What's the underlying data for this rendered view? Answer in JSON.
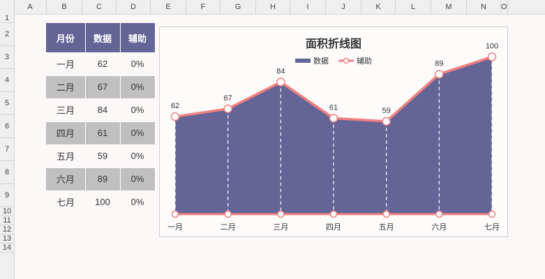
{
  "sheet": {
    "columns": [
      "A",
      "B",
      "C",
      "D",
      "E",
      "F",
      "G",
      "H",
      "I",
      "J",
      "K",
      "L",
      "M",
      "N",
      "O"
    ],
    "rows": [
      "1",
      "2",
      "3",
      "4",
      "5",
      "6",
      "7",
      "8",
      "9",
      "10",
      "11",
      "12",
      "13",
      "14"
    ]
  },
  "table": {
    "headers": [
      "月份",
      "数据",
      "辅助"
    ],
    "rows": [
      [
        "一月",
        "62",
        "0%"
      ],
      [
        "二月",
        "67",
        "0%"
      ],
      [
        "三月",
        "84",
        "0%"
      ],
      [
        "四月",
        "61",
        "0%"
      ],
      [
        "五月",
        "59",
        "0%"
      ],
      [
        "六月",
        "89",
        "0%"
      ],
      [
        "七月",
        "100",
        "0%"
      ]
    ]
  },
  "chart_data": {
    "type": "area",
    "title": "面积折线图",
    "categories": [
      "一月",
      "二月",
      "三月",
      "四月",
      "五月",
      "六月",
      "七月"
    ],
    "series": [
      {
        "name": "数据",
        "values": [
          62,
          67,
          84,
          61,
          59,
          89,
          100
        ],
        "color": "#646496"
      },
      {
        "name": "辅助",
        "values": [
          0,
          0,
          0,
          0,
          0,
          0,
          0
        ],
        "color": "#f08080"
      }
    ],
    "ylim": [
      0,
      110
    ],
    "grid": false,
    "legend": "top"
  }
}
